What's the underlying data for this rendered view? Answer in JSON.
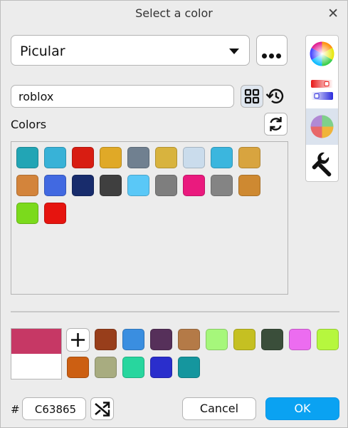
{
  "dialog": {
    "title": "Select a color"
  },
  "picker": {
    "selected": "Picular"
  },
  "search": {
    "value": "roblox",
    "placeholder": ""
  },
  "colors_section": {
    "label": "Colors"
  },
  "palette": [
    "#22A5B5",
    "#38B2D7",
    "#D81D12",
    "#E0A927",
    "#708090",
    "#D8B33E",
    "#CADCEC",
    "#3BB6DE",
    "#D8A43F",
    "#D3843B",
    "#4169E1",
    "#182C6C",
    "#3F3F3F",
    "#5AC8F7",
    "#7E7E7E",
    "#EA1A7E",
    "#848484",
    "#CE8931",
    "#7BDA1C",
    "#E6140F"
  ],
  "custom_colors": [
    "#983E1B",
    "#3A8EE0",
    "#56305A",
    "#B47A47",
    "#A6F77B",
    "#C5C022",
    "#3A4E3A",
    "#EC6CF0",
    "#B6F73E",
    "#CC5F12",
    "#A8AC80",
    "#28D69E",
    "#2A2ECC",
    "#15969E"
  ],
  "compare": {
    "new_color": "#C63865",
    "old_color": "#FFFFFF"
  },
  "hex": {
    "prefix": "#",
    "value": "C63865"
  },
  "buttons": {
    "cancel": "Cancel",
    "ok": "OK"
  },
  "side_tabs": [
    "color-wheel-icon",
    "sliders-icon",
    "palette-icon",
    "wrench-icon"
  ],
  "accent": "#0AA2F2"
}
